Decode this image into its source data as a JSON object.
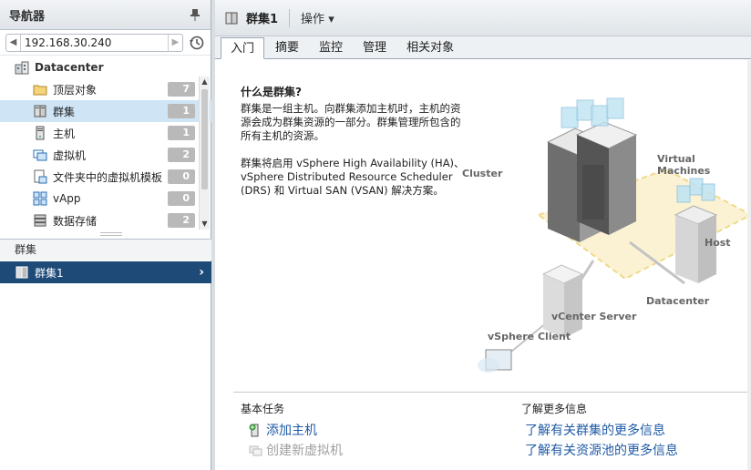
{
  "navigator": {
    "title": "导航器",
    "address": "192.168.30.240",
    "datacenter": "Datacenter",
    "items": [
      {
        "label": "顶层对象",
        "count": "7",
        "icon": "folder-icon"
      },
      {
        "label": "群集",
        "count": "1",
        "icon": "cluster-icon",
        "selected": true
      },
      {
        "label": "主机",
        "count": "1",
        "icon": "host-icon"
      },
      {
        "label": "虚拟机",
        "count": "2",
        "icon": "vm-icon"
      },
      {
        "label": "文件夹中的虚拟机模板",
        "count": "0",
        "icon": "template-icon"
      },
      {
        "label": "vApp",
        "count": "0",
        "icon": "vapp-icon"
      },
      {
        "label": "数据存储",
        "count": "2",
        "icon": "datastore-icon"
      }
    ],
    "section_label": "群集",
    "selected_cluster": "群集1"
  },
  "main": {
    "title": "群集1",
    "actions_label": "操作",
    "tabs": [
      "入门",
      "摘要",
      "监控",
      "管理",
      "相关对象"
    ],
    "active_tab": 0
  },
  "intro": {
    "title": "什么是群集?",
    "para1": "群集是一组主机。向群集添加主机时，主机的资源会成为群集资源的一部分。群集管理所包含的所有主机的资源。",
    "para2": "群集将启用 vSphere High Availability (HA)、vSphere Distributed Resource Scheduler (DRS) 和 Virtual SAN (VSAN) 解决方案。"
  },
  "diagram_labels": {
    "cluster": "Cluster",
    "vms": "Virtual Machines",
    "host": "Host",
    "datacenter": "Datacenter",
    "vcenter": "vCenter Server",
    "client": "vSphere Client"
  },
  "basic_tasks": {
    "title": "基本任务",
    "add_host": "添加主机",
    "create_vm": "创建新虚拟机"
  },
  "learn_more": {
    "title": "了解更多信息",
    "link1": "了解有关群集的更多信息",
    "link2": "了解有关资源池的更多信息"
  },
  "colors": {
    "selected_row": "#cfe5f5",
    "active_cluster_row": "#1e4a78",
    "link": "#1f5aa6",
    "badge": "#b9b9b9"
  }
}
